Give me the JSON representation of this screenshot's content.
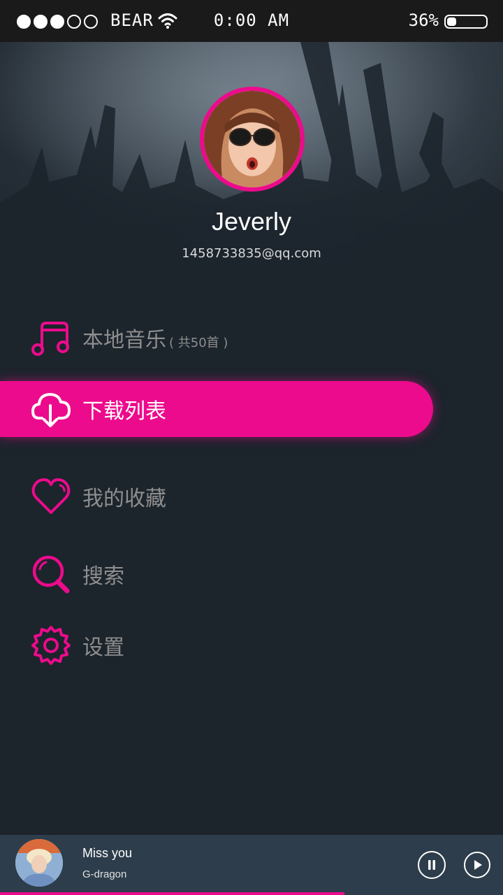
{
  "status_bar": {
    "carrier": "BEAR",
    "time": "0:00 AM",
    "battery_percent_label": "36%",
    "battery_level": 0.22,
    "signal_bars_filled": 3,
    "signal_bars_total": 5
  },
  "profile": {
    "name": "Jeverly",
    "email": "1458733835@qq.com"
  },
  "menu": {
    "items": [
      {
        "label": "本地音乐",
        "count": "( 共50首 )",
        "icon": "music-note-icon"
      },
      {
        "label": "下载列表",
        "icon": "cloud-download-icon",
        "active": true
      },
      {
        "label": "我的收藏",
        "icon": "heart-icon"
      },
      {
        "label": "搜索",
        "icon": "search-icon"
      },
      {
        "label": "设置",
        "icon": "gear-icon"
      }
    ]
  },
  "player": {
    "song": "Miss you",
    "artist": "G-dragon",
    "progress": 0.685
  },
  "colors": {
    "accent": "#ec0b8c",
    "background": "#1c242c",
    "player_bg": "#2d3d4b",
    "muted_text": "#8e8e8e"
  }
}
